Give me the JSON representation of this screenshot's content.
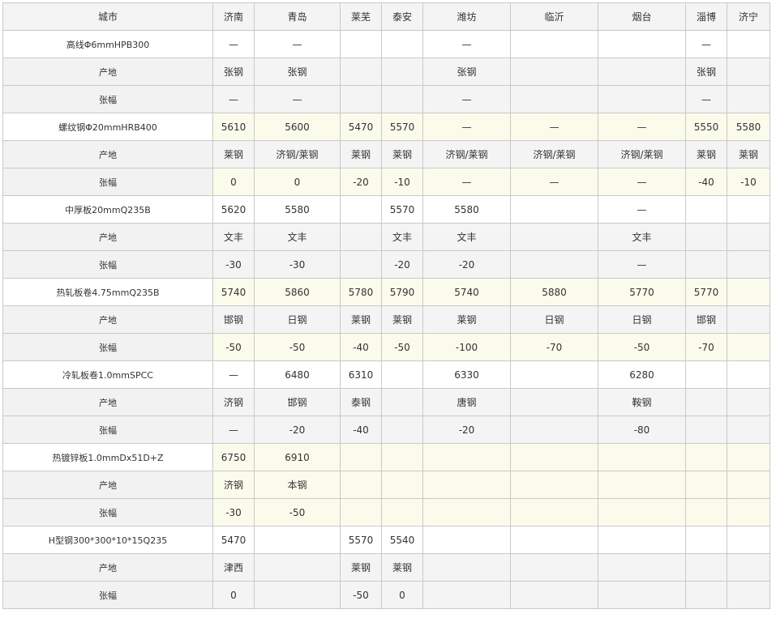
{
  "header": [
    "城市",
    "济南",
    "青岛",
    "莱芜",
    "泰安",
    "潍坊",
    "临沂",
    "烟台",
    "淄博",
    "济宁"
  ],
  "rows": [
    {
      "cells": [
        "高线Φ6mmHPB300",
        "—",
        "—",
        "",
        "",
        "—",
        "",
        "",
        "—",
        ""
      ],
      "sub": false,
      "hl": []
    },
    {
      "cells": [
        "产地",
        "张钢",
        "张钢",
        "",
        "",
        "张钢",
        "",
        "",
        "张钢",
        ""
      ],
      "sub": true,
      "hl": []
    },
    {
      "cells": [
        "张幅",
        "—",
        "—",
        "",
        "",
        "—",
        "",
        "",
        "—",
        ""
      ],
      "sub": true,
      "hl": []
    },
    {
      "cells": [
        "螺纹钢Φ20mmHRB400",
        "5610",
        "5600",
        "5470",
        "5570",
        "—",
        "—",
        "—",
        "5550",
        "5580"
      ],
      "sub": false,
      "hl": [
        1,
        2,
        3,
        4,
        5,
        6,
        7,
        8,
        9
      ]
    },
    {
      "cells": [
        "产地",
        "莱钢",
        "济钢/莱钢",
        "莱钢",
        "莱钢",
        "济钢/莱钢",
        "济钢/莱钢",
        "济钢/莱钢",
        "莱钢",
        "莱钢"
      ],
      "sub": true,
      "hl": []
    },
    {
      "cells": [
        "张幅",
        "0",
        "0",
        "-20",
        "-10",
        "—",
        "—",
        "—",
        "-40",
        "-10"
      ],
      "sub": true,
      "hl": [
        1,
        2,
        3,
        4,
        5,
        6,
        7,
        8,
        9
      ]
    },
    {
      "cells": [
        "中厚板20mmQ235B",
        "5620",
        "5580",
        "",
        "5570",
        "5580",
        "",
        "—",
        "",
        ""
      ],
      "sub": false,
      "hl": []
    },
    {
      "cells": [
        "产地",
        "文丰",
        "文丰",
        "",
        "文丰",
        "文丰",
        "",
        "文丰",
        "",
        ""
      ],
      "sub": true,
      "hl": []
    },
    {
      "cells": [
        "张幅",
        "-30",
        "-30",
        "",
        "-20",
        "-20",
        "",
        "—",
        "",
        ""
      ],
      "sub": true,
      "hl": []
    },
    {
      "cells": [
        "热轧板卷4.75mmQ235B",
        "5740",
        "5860",
        "5780",
        "5790",
        "5740",
        "5880",
        "5770",
        "5770",
        ""
      ],
      "sub": false,
      "hl": [
        1,
        2,
        3,
        4,
        5,
        6,
        7,
        8,
        9
      ]
    },
    {
      "cells": [
        "产地",
        "邯钢",
        "日钢",
        "莱钢",
        "莱钢",
        "莱钢",
        "日钢",
        "日钢",
        "邯钢",
        ""
      ],
      "sub": true,
      "hl": []
    },
    {
      "cells": [
        "张幅",
        "-50",
        "-50",
        "-40",
        "-50",
        "-100",
        "-70",
        "-50",
        "-70",
        ""
      ],
      "sub": true,
      "hl": [
        1,
        2,
        3,
        4,
        5,
        6,
        7,
        8,
        9
      ]
    },
    {
      "cells": [
        "冷轧板卷1.0mmSPCC",
        "—",
        "6480",
        "6310",
        "",
        "6330",
        "",
        "6280",
        "",
        ""
      ],
      "sub": false,
      "hl": []
    },
    {
      "cells": [
        "产地",
        "济钢",
        "邯钢",
        "泰钢",
        "",
        "唐钢",
        "",
        "鞍钢",
        "",
        ""
      ],
      "sub": true,
      "hl": []
    },
    {
      "cells": [
        "张幅",
        "—",
        "-20",
        "-40",
        "",
        "-20",
        "",
        "-80",
        "",
        ""
      ],
      "sub": true,
      "hl": []
    },
    {
      "cells": [
        "热镀锌板1.0mmDx51D+Z",
        "6750",
        "6910",
        "",
        "",
        "",
        "",
        "",
        "",
        ""
      ],
      "sub": false,
      "hl": [
        1,
        2,
        3,
        4,
        5,
        6,
        7,
        8,
        9
      ]
    },
    {
      "cells": [
        "产地",
        "济钢",
        "本钢",
        "",
        "",
        "",
        "",
        "",
        "",
        ""
      ],
      "sub": true,
      "hl": [
        1,
        2,
        3,
        4,
        5,
        6,
        7,
        8,
        9
      ]
    },
    {
      "cells": [
        "张幅",
        "-30",
        "-50",
        "",
        "",
        "",
        "",
        "",
        "",
        ""
      ],
      "sub": true,
      "hl": [
        1,
        2,
        3,
        4,
        5,
        6,
        7,
        8,
        9
      ]
    },
    {
      "cells": [
        "H型钢300*300*10*15Q235",
        "5470",
        "",
        "5570",
        "5540",
        "",
        "",
        "",
        "",
        ""
      ],
      "sub": false,
      "hl": []
    },
    {
      "cells": [
        "产地",
        "津西",
        "",
        "莱钢",
        "莱钢",
        "",
        "",
        "",
        "",
        ""
      ],
      "sub": true,
      "hl": []
    },
    {
      "cells": [
        "张幅",
        "0",
        "",
        "-50",
        "0",
        "",
        "",
        "",
        "",
        ""
      ],
      "sub": true,
      "hl": []
    }
  ]
}
